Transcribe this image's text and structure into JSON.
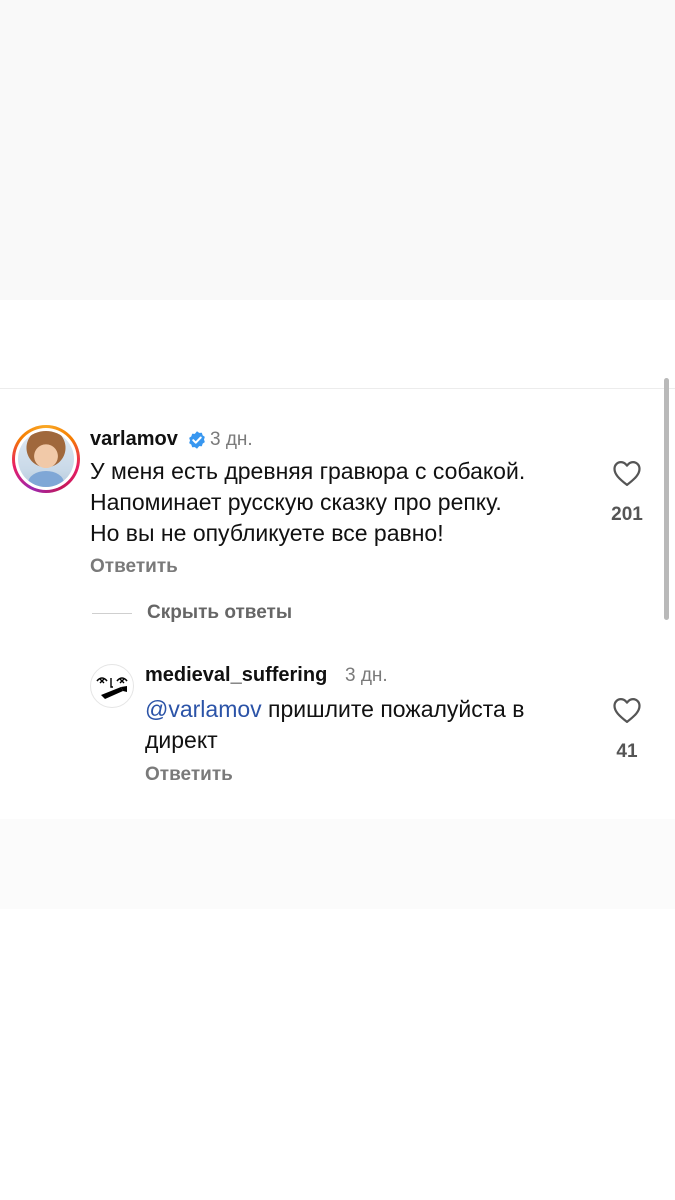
{
  "thread": {
    "comment": {
      "username": "varlamov",
      "time": "3 дн.",
      "lines": [
        "У меня есть древняя гравюра с собакой.",
        "Напоминает русскую сказку про репку.",
        "Но вы не опубликуете все равно!"
      ],
      "reply_label": "Ответить",
      "likes": "201",
      "verified_icon": "verified-badge-icon",
      "like_icon": "heart-outline-icon"
    },
    "hide_replies_label": "Скрыть ответы",
    "reply": {
      "username": "medieval_suffering",
      "time": "3 дн.",
      "mention": "@varlamov",
      "text_rest": " пришлите пожалуйста в",
      "text_line2": "директ",
      "reply_label": "Ответить",
      "likes": "41",
      "like_icon": "heart-outline-icon"
    }
  },
  "colors": {
    "accent_mention": "#2b53a7",
    "verified": "#3897f0",
    "muted": "#7a7a7a"
  }
}
